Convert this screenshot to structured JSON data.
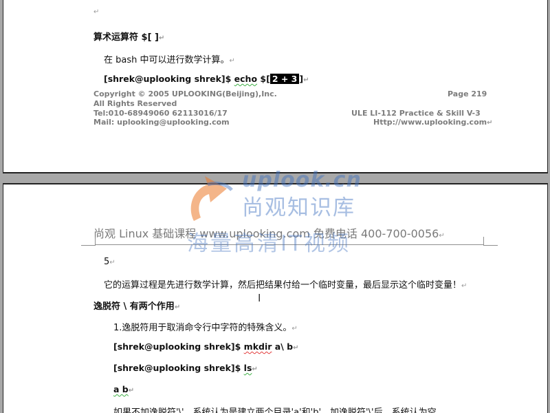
{
  "top_page": {
    "para_mark": "↵",
    "heading": "算术运算符  $[ ]",
    "body": "在 bash 中可以进行数学计算。",
    "cmd_prefix": "[shrek@uplooking shrek]$ ",
    "cmd_echo": "echo",
    "cmd_rest": " $[",
    "cmd_selected": "2 + 3",
    "cmd_close": "]",
    "footer": {
      "copyright": "Copyright © 2005 UPLOOKING(Beijing),Inc.",
      "rights": "All Rights Reserved",
      "tel": "Tel:010-68949060 62113016/17",
      "mail": "Mail: uplooking@uplooking.com",
      "page": "Page  219",
      "course": "ULE LI-112 Practice & Skill   V-3",
      "url": "Http://www.uplooking.com"
    }
  },
  "watermark": {
    "brand": "uplook.cn",
    "line1": "尚观知识库",
    "line2": "海量高清IT视频"
  },
  "bottom_page": {
    "header": "尚观 Linux 基础课程      www.uplooking.com   免费电话 400-700-0056",
    "result": "5",
    "explanation": "它的运算过程是先进行数学计算，然后把结果付给一个临时变量，最后显示这个临时变量！",
    "heading2": "逸脱符    \\    有两个作用",
    "point1": "1.逸脱符用于取消命令行中字符的特殊含义。",
    "cmd1_prefix": "[shrek@uplooking shrek]$ ",
    "cmd1_cmd": "mkdir",
    "cmd1_rest": " a\\ b",
    "cmd2_prefix": "[shrek@uplooking shrek]$ ",
    "cmd2_cmd": "ls",
    "output": "a b",
    "last_line": "如果不加逸脱符'\\'，系统认为是建立两个目录'a'和'b'，加逸脱符'\\'后，系统认为空"
  }
}
